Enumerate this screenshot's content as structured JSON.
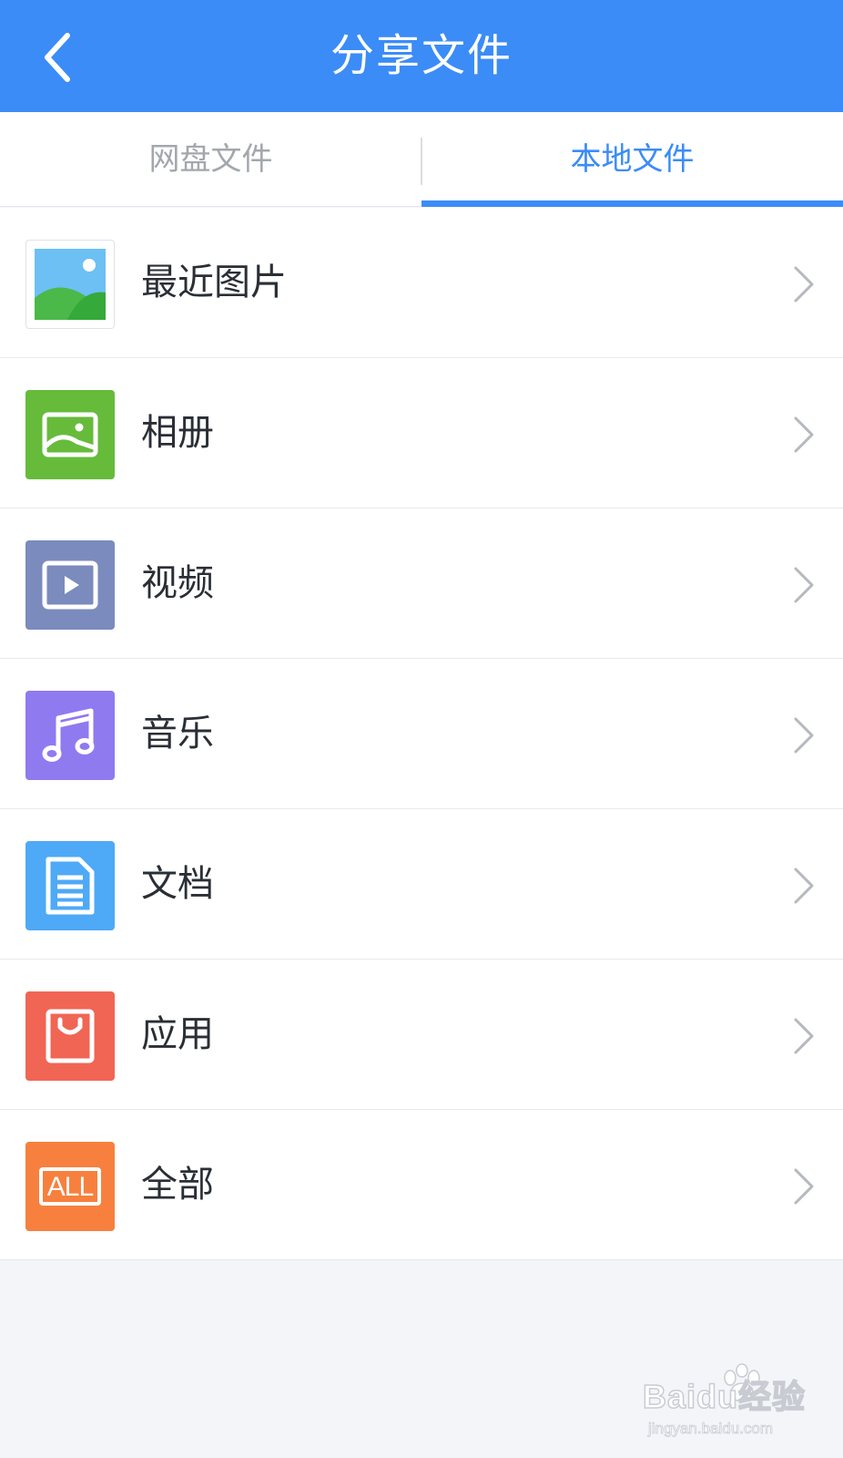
{
  "header": {
    "title": "分享文件",
    "back_icon": "chevron-left-icon",
    "bg_color": "#3b8cf7"
  },
  "tabs": [
    {
      "label": "网盘文件",
      "active": false
    },
    {
      "label": "本地文件",
      "active": true
    }
  ],
  "list": {
    "items": [
      {
        "label": "最近图片",
        "icon": "landscape-photo-icon",
        "icon_color": "#ffffff"
      },
      {
        "label": "相册",
        "icon": "album-image-icon",
        "icon_color": "#67bb3b"
      },
      {
        "label": "视频",
        "icon": "video-play-icon",
        "icon_color": "#7b8bbd"
      },
      {
        "label": "音乐",
        "icon": "music-note-icon",
        "icon_color": "#8f7af0"
      },
      {
        "label": "文档",
        "icon": "document-icon",
        "icon_color": "#4ea9f6"
      },
      {
        "label": "应用",
        "icon": "shopping-bag-icon",
        "icon_color": "#f16554"
      },
      {
        "label": "全部",
        "icon": "all-files-icon",
        "icon_color": "#f7803e",
        "icon_text": "ALL"
      }
    ]
  },
  "watermark": {
    "brand": "Baidu经验",
    "url": "jingyan.baidu.com"
  }
}
